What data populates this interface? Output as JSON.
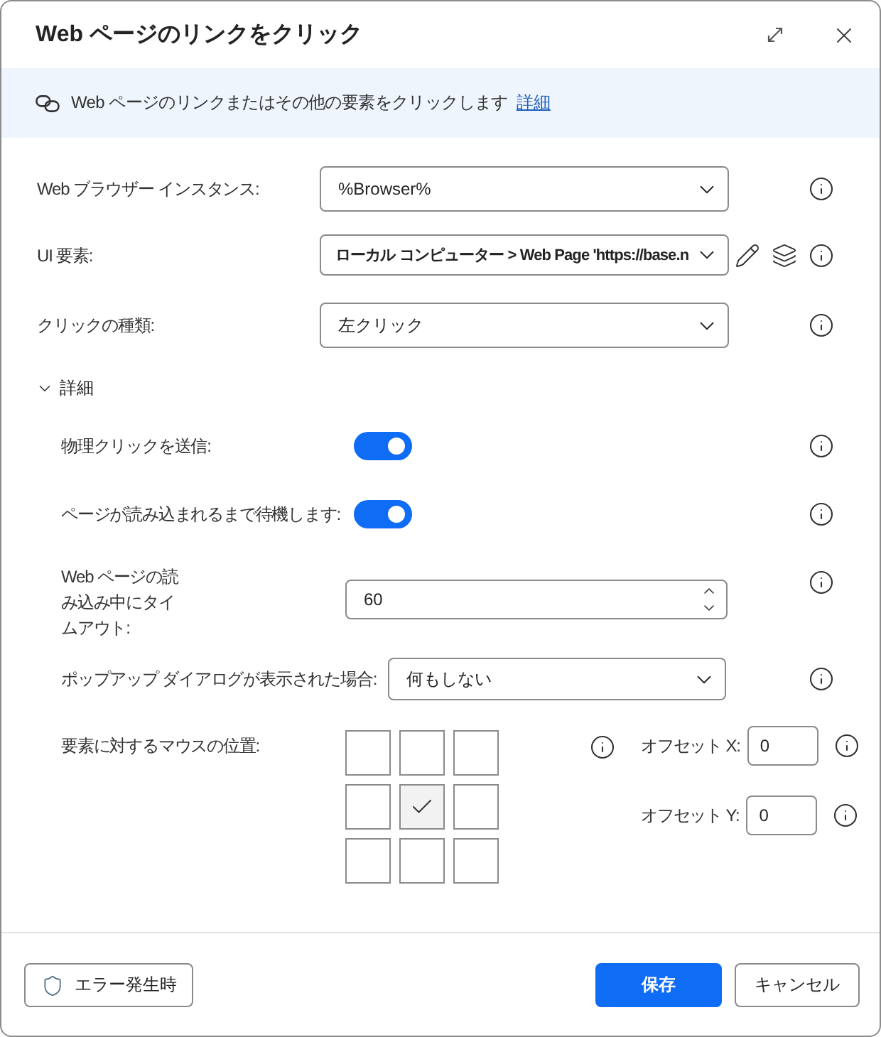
{
  "window": {
    "title": "Web ページのリンクをクリック"
  },
  "banner": {
    "text": "Web ページのリンクまたはその他の要素をクリックします",
    "link": "詳細"
  },
  "fields": [
    {
      "kind": "dropdown",
      "label": "Web ブラウザー インスタンス:",
      "value": "%Browser%"
    },
    {
      "kind": "element",
      "label": "UI 要素:",
      "value": "ローカル コンピューター > Web Page 'https://base.n"
    },
    {
      "kind": "dropdown",
      "label": "クリックの種類:",
      "value": "左クリック"
    }
  ],
  "advanced": {
    "label": "詳細",
    "expanded": true,
    "fields": [
      {
        "kind": "toggle",
        "label": "物理クリックを送信:",
        "on": true
      },
      {
        "kind": "toggle",
        "label": "ページが読み込まれるまで待機します:",
        "on": true
      },
      {
        "kind": "number",
        "label": "Web ページの読み込み中にタイムアウト:",
        "value": "60"
      },
      {
        "kind": "dropdown",
        "label": "ポップアップ ダイアログが表示された場合:",
        "value": "何もしない"
      },
      {
        "kind": "position",
        "label": "要素に対するマウスの位置:",
        "cells": [
          {
            "selected": false
          },
          {
            "selected": false
          },
          {
            "selected": false
          },
          {
            "selected": false
          },
          {
            "selected": true
          },
          {
            "selected": false
          },
          {
            "selected": false
          },
          {
            "selected": false
          },
          {
            "selected": false
          }
        ],
        "offsets": [
          {
            "label": "オフセット X:",
            "value": "0"
          },
          {
            "label": "オフセット Y:",
            "value": "0"
          }
        ]
      }
    ]
  },
  "footer": {
    "error_button": "エラー発生時",
    "buttons": [
      {
        "kind": "primary",
        "label": "保存"
      },
      {
        "kind": "secondary",
        "label": "キャンセル"
      }
    ]
  }
}
